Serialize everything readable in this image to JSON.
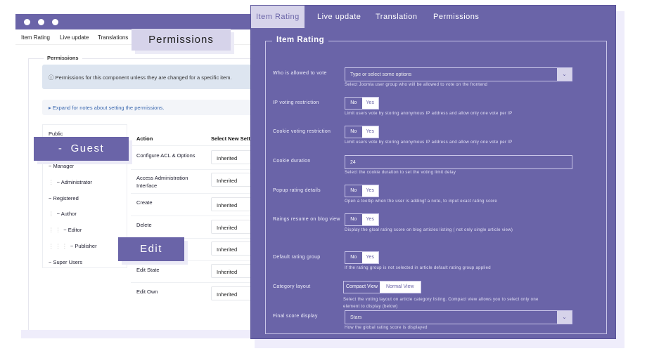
{
  "back_window": {
    "tabs": [
      "Item Rating",
      "Live update",
      "Translations"
    ],
    "section": "Permissions",
    "info": "Permissions for this component unless they are changed for a specific item.",
    "expand": "Expand for notes about setting the permissions.",
    "groups": [
      "Public",
      "Manager",
      "Administrator",
      "Registered",
      "Author",
      "Editor",
      "Publisher",
      "Super Users"
    ],
    "table": {
      "headers": [
        "Action",
        "Select New Setti"
      ],
      "rows": [
        {
          "action": "Configure ACL & Options",
          "value": "Inherited"
        },
        {
          "action": "Access Administration Interface",
          "value": "Inherited"
        },
        {
          "action": "Create",
          "value": "Inherited"
        },
        {
          "action": "Delete",
          "value": "Inherited"
        },
        {
          "action": "",
          "value": "Inherited"
        },
        {
          "action": "Edit State",
          "value": "Inherited"
        },
        {
          "action": "Edit Own",
          "value": "Inherited"
        }
      ]
    }
  },
  "callouts": {
    "permissions": "Permissions",
    "guest": "-  Guest",
    "edit": "Edit"
  },
  "front_panel": {
    "tabs": [
      "Item Rating",
      "Live update",
      "Translation",
      "Permissions"
    ],
    "active_tab": "Item Rating",
    "legend": "Item Rating",
    "fields": {
      "vote": {
        "label": "Who is allowed to vote",
        "placeholder": "Type or select some options",
        "help": "Select Joomla user group  who will be allowed to vote on the frontend"
      },
      "ip": {
        "label": "IP voting restriction",
        "no": "No",
        "yes": "Yes",
        "help": "Limit users vote by storing anonymous IP address and allow only one vote per IP"
      },
      "cookie": {
        "label": "Cookie voting restriction",
        "no": "No",
        "yes": "Yes",
        "help": "Limit users vote by storing anonymous IP address and allow only one vote per IP"
      },
      "duration": {
        "label": "Cookie duration",
        "value": "24",
        "help": "Select the cookie duration to set the voting limit delay"
      },
      "popup": {
        "label": "Popup rating details",
        "no": "No",
        "yes": "Yes",
        "help": "Open a tooltip when the user is addingf a note, to input exact rating score"
      },
      "resume": {
        "label": "Raings resume on blog view",
        "no": "No",
        "yes": "Yes",
        "help": "Display the gloal rating score on blog articles listing ( not only single article view)"
      },
      "default_group": {
        "label": "Default rating group",
        "no": "No",
        "yes": "Yes",
        "help": "If the rating group is not selected in article default rating group applied"
      },
      "layout": {
        "label": "Category layout",
        "options": [
          "Compact View",
          "Normal View"
        ],
        "help": "Select the voting layout on article category listing. Compact view allows you to select only one element to display (below)"
      },
      "final": {
        "label": "Final score display",
        "value": "Stars",
        "help": "How the global rating score is displayed"
      }
    }
  },
  "colors": {
    "accent": "#6a64a8",
    "accent_light": "#d6d3ea",
    "shadow": "#efedfb"
  }
}
